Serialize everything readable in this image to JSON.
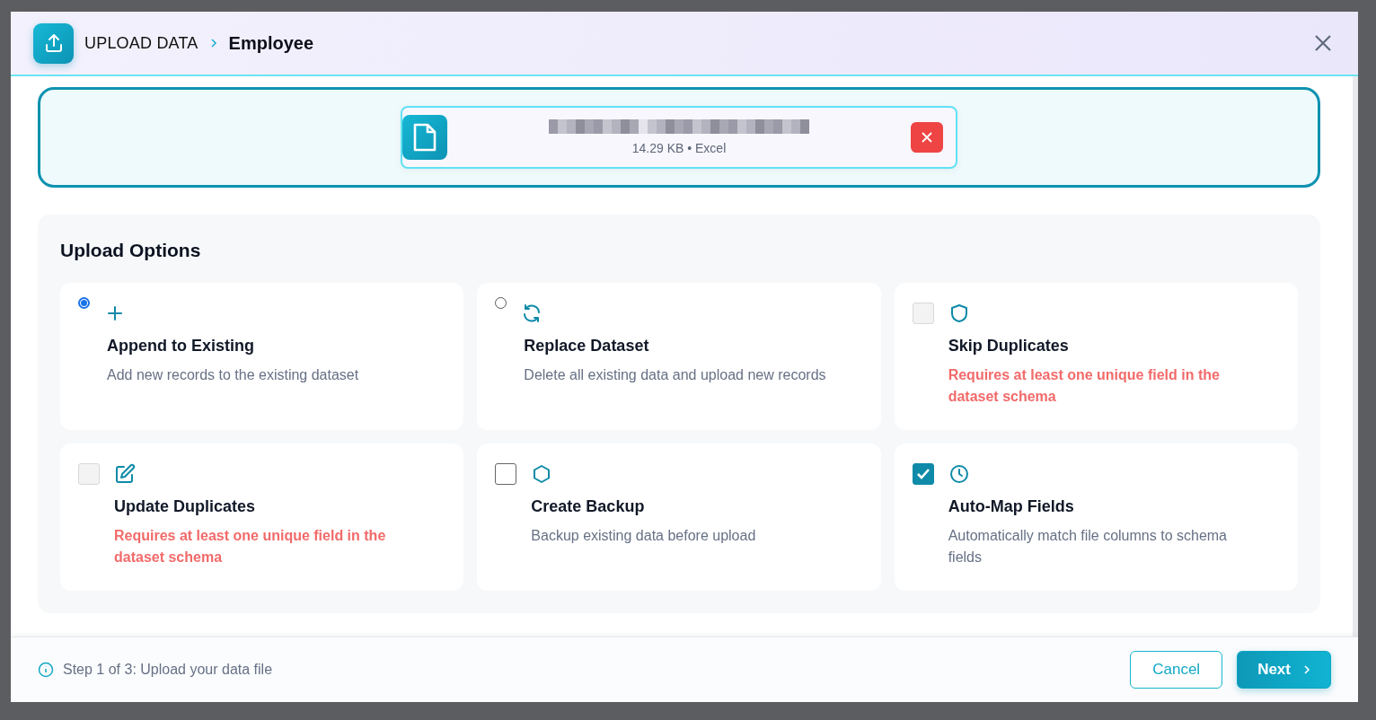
{
  "header": {
    "title": "UPLOAD DATA",
    "subtitle": "Employee"
  },
  "file": {
    "meta": "14.29 KB • Excel"
  },
  "options_panel": {
    "title": "Upload Options",
    "options": [
      {
        "kind": "radio",
        "selected": true,
        "title": "Append to Existing",
        "description": "Add new records to the existing dataset",
        "warning": false
      },
      {
        "kind": "radio",
        "selected": false,
        "title": "Replace Dataset",
        "description": "Delete all existing data and upload new records",
        "warning": false
      },
      {
        "kind": "checkbox",
        "checked": false,
        "disabled": true,
        "title": "Skip Duplicates",
        "description": "Requires at least one unique field in the dataset schema",
        "warning": true
      },
      {
        "kind": "checkbox",
        "checked": false,
        "disabled": true,
        "title": "Update Duplicates",
        "description": "Requires at least one unique field in the dataset schema",
        "warning": true
      },
      {
        "kind": "checkbox",
        "checked": false,
        "disabled": false,
        "title": "Create Backup",
        "description": "Backup existing data before upload",
        "warning": false
      },
      {
        "kind": "checkbox",
        "checked": true,
        "disabled": false,
        "title": "Auto-Map Fields",
        "description": "Automatically match file columns to schema fields",
        "warning": false
      }
    ]
  },
  "footer": {
    "step": "Step 1 of 3: Upload your data file",
    "buttons": [
      {
        "kind": "secondary",
        "label": "Cancel"
      },
      {
        "kind": "primary",
        "label": "Next"
      }
    ]
  }
}
